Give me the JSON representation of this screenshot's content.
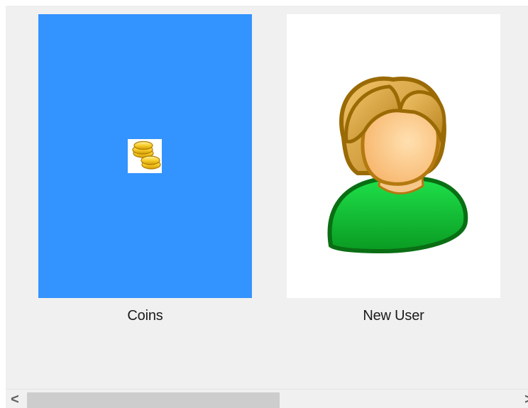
{
  "items": [
    {
      "label": "Coins",
      "icon": "coins-icon",
      "selected": true
    },
    {
      "label": "New User",
      "icon": "user-icon",
      "selected": false
    }
  ],
  "scrollbar": {
    "left_arrow": "<",
    "right_arrow": ">",
    "thumb_fraction": 0.49,
    "position": 0
  },
  "colors": {
    "background": "#f0f0f0",
    "selection": "#3393ff",
    "thumbnail_bg": "#ffffff",
    "scroll_thumb": "#cdcdcd"
  }
}
